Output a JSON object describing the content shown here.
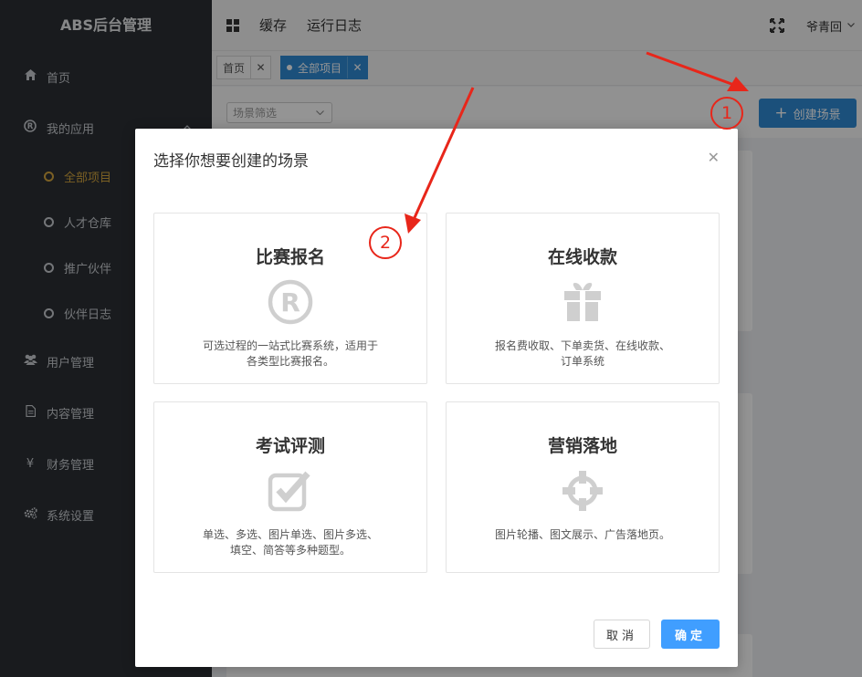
{
  "app": {
    "title": "ABS后台管理"
  },
  "sidebar": {
    "items": [
      {
        "label": "首页",
        "icon": "home-icon"
      },
      {
        "label": "我的应用",
        "icon": "registered-icon"
      },
      {
        "label": "用户管理",
        "icon": "users-icon"
      },
      {
        "label": "内容管理",
        "icon": "document-icon"
      },
      {
        "label": "财务管理",
        "icon": "yen-icon"
      },
      {
        "label": "系统设置",
        "icon": "gears-icon"
      }
    ],
    "sub_items": [
      {
        "label": "全部项目",
        "active": true
      },
      {
        "label": "人才仓库"
      },
      {
        "label": "推广伙伴"
      },
      {
        "label": "伙伴日志"
      }
    ],
    "yen_glyph": "¥"
  },
  "topbar": {
    "links": [
      "缓存",
      "运行日志"
    ],
    "user": "爷青回"
  },
  "tabs": [
    {
      "label": "首页"
    },
    {
      "label": "全部项目",
      "active": true
    }
  ],
  "content": {
    "filter_placeholder": "场景筛选",
    "create_button": "创建场景"
  },
  "modal": {
    "title": "选择你想要创建的场景",
    "cards": [
      {
        "title": "比赛报名",
        "icon": "registered-icon",
        "desc": "可选过程的一站式比赛系统，适用于各类型比赛报名。"
      },
      {
        "title": "在线收款",
        "icon": "gift-icon",
        "desc": "报名费收取、下单卖货、在线收款、订单系统"
      },
      {
        "title": "考试评测",
        "icon": "checkbox-icon",
        "desc": "单选、多选、图片单选、图片多选、填空、简答等多种题型。"
      },
      {
        "title": "营销落地",
        "icon": "crosshair-icon",
        "desc": "图片轮播、图文展示、广告落地页。"
      }
    ],
    "cancel": "取消",
    "ok": "确定"
  },
  "annotations": [
    {
      "label": "1"
    },
    {
      "label": "2"
    }
  ],
  "colors": {
    "sidebar_bg": "#2b2f34",
    "accent": "#2f8bd5",
    "active_sub": "#d4a53e",
    "primary_btn": "#409eff",
    "annotation": "#e8261a"
  }
}
